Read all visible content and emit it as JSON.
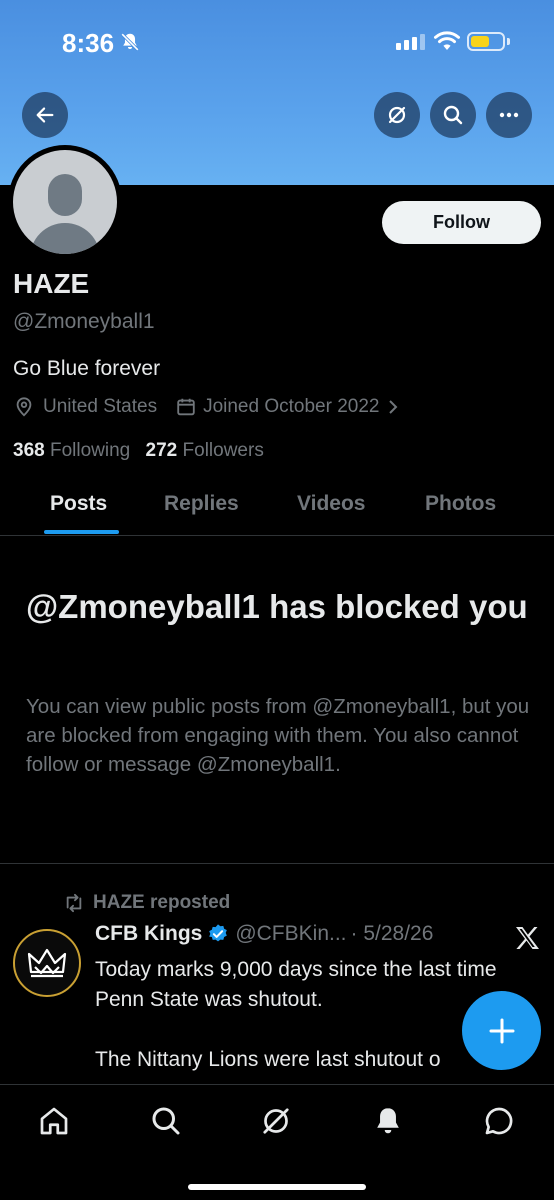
{
  "status_bar": {
    "time": "8:36"
  },
  "profile": {
    "name": "HAZE",
    "handle": "@Zmoneyball1",
    "bio": "Go Blue forever",
    "location": "United States",
    "joined": "Joined October 2022",
    "following_count": "368",
    "following_label": "Following",
    "followers_count": "272",
    "followers_label": "Followers",
    "follow_label": "Follow"
  },
  "tabs": [
    "Posts",
    "Replies",
    "Videos",
    "Photos"
  ],
  "blocked": {
    "title": "@Zmoneyball1 has blocked you",
    "description": "You can view public posts from @Zmoneyball1, but you are blocked from engaging with them. You also cannot follow or message @Zmoneyball1."
  },
  "post": {
    "repost_label": "HAZE reposted",
    "author": "CFB Kings",
    "handle": "@CFBKin...",
    "date": "· 5/28/26",
    "text": "Today marks 9,000 days since the last time Penn State was shutout.\n\nThe Nittany Lions were last shutout o"
  },
  "icons": {
    "back": "arrow-left-icon",
    "grok": "grok-icon",
    "search": "search-icon",
    "more": "more-icon",
    "compose": "plus-icon"
  },
  "colors": {
    "accent": "#1d9bf0",
    "verified": "#1d9bf0",
    "banner": "#5aa2ec"
  }
}
